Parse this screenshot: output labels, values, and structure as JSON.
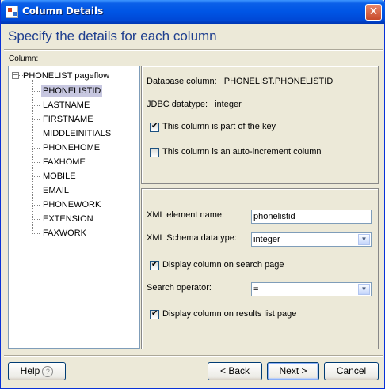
{
  "window": {
    "title": "Column Details",
    "close_glyph": "✕"
  },
  "header": {
    "title": "Specify the details for each column"
  },
  "column_label": "Column:",
  "tree": {
    "root_toggle": "−",
    "root": "PHONELIST pageflow",
    "items": [
      "PHONELISTID",
      "LASTNAME",
      "FIRSTNAME",
      "MIDDLEINITIALS",
      "PHONEHOME",
      "FAXHOME",
      "MOBILE",
      "EMAIL",
      "PHONEWORK",
      "EXTENSION",
      "FAXWORK"
    ],
    "selected": "PHONELISTID"
  },
  "db_panel": {
    "database_column_label": "Database column:",
    "database_column_value": "PHONELIST.PHONELISTID",
    "jdbc_label": "JDBC datatype:",
    "jdbc_value": "integer",
    "key_checkbox": {
      "label": "This column is part of the key",
      "checked": true
    },
    "autoinc_checkbox": {
      "label": "This column is an auto-increment column",
      "checked": false
    }
  },
  "xml_panel": {
    "element_name_label": "XML element name:",
    "element_name_value": "phonelistid",
    "schema_label": "XML Schema datatype:",
    "schema_value": "integer",
    "search_page_checkbox": {
      "label": "Display column on search page",
      "checked": true
    },
    "search_operator_label": "Search operator:",
    "search_operator_value": "=",
    "results_checkbox": {
      "label": "Display column on results list page",
      "checked": true
    }
  },
  "footer": {
    "help": "Help",
    "help_icon": "?",
    "back": "< Back",
    "next": "Next >",
    "cancel": "Cancel"
  },
  "colors": {
    "title_bar": "#0055e5",
    "header_text": "#1f3f8f",
    "selection": "#c7c7e0"
  }
}
